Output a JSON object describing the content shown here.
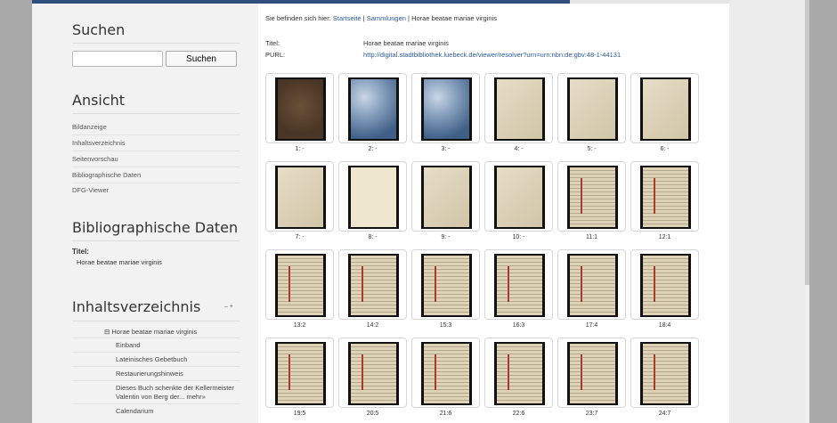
{
  "sidebar": {
    "search_heading": "Suchen",
    "search_placeholder": "",
    "search_button": "Suchen",
    "view_heading": "Ansicht",
    "view_links": [
      "Bildanzeige",
      "Inhaltsverzeichnis",
      "Seitenvorschau",
      "Bibliographische Daten",
      "DFG-Viewer"
    ],
    "bib_heading": "Bibliographische Daten",
    "bib_title_label": "Titel:",
    "bib_title_value": "Horae beatae mariae virginis",
    "toc_heading": "Inhaltsverzeichnis",
    "toc_toggle": "– +",
    "toc_root": "⊟ Horae beatae mariae virginis",
    "toc_items": [
      "Einband",
      "Lateinisches Gebetbuch",
      "Restaurierungshinweis",
      "Dieses Buch schenkte der Kellermeister",
      "Valentin von Berg der... mehr»",
      "Calendarium"
    ]
  },
  "breadcrumb": {
    "prefix": "Sie befinden sich hier:",
    "home": "Startseite",
    "sep": "|",
    "collections": "Sammlungen",
    "current": "Horae beatae mariae virginis"
  },
  "meta": {
    "title_label": "Titel:",
    "title_value": "Horae beatae mariae virginis",
    "purl_label": "PURL:",
    "purl_value": "http://digital.stadtbibliothek.luebeck.de/viewer/resolver?urn=urn:nbn:de:gbv:48-1-44131"
  },
  "thumbnails": [
    {
      "label": "1: -",
      "kind": "cover"
    },
    {
      "label": "2: -",
      "kind": "marble"
    },
    {
      "label": "3: -",
      "kind": "marble"
    },
    {
      "label": "4: -",
      "kind": "page"
    },
    {
      "label": "5: -",
      "kind": "page"
    },
    {
      "label": "6: -",
      "kind": "page"
    },
    {
      "label": "7: -",
      "kind": "page"
    },
    {
      "label": "8: -",
      "kind": "blank"
    },
    {
      "label": "9: -",
      "kind": "page"
    },
    {
      "label": "10: -",
      "kind": "page"
    },
    {
      "label": "11:1",
      "kind": "text"
    },
    {
      "label": "12:1",
      "kind": "text"
    },
    {
      "label": "13:2",
      "kind": "text"
    },
    {
      "label": "14:2",
      "kind": "text"
    },
    {
      "label": "15:3",
      "kind": "text"
    },
    {
      "label": "16:3",
      "kind": "text"
    },
    {
      "label": "17:4",
      "kind": "text"
    },
    {
      "label": "18:4",
      "kind": "text"
    },
    {
      "label": "19:5",
      "kind": "text"
    },
    {
      "label": "20:5",
      "kind": "text"
    },
    {
      "label": "21:6",
      "kind": "text"
    },
    {
      "label": "22:6",
      "kind": "text"
    },
    {
      "label": "23:7",
      "kind": "text"
    },
    {
      "label": "24:7",
      "kind": "text"
    }
  ],
  "colors": {
    "cover": "#4a3626",
    "marble": "#7f99b8",
    "page": "#e6ddc7",
    "blank": "#efe6cf",
    "text": "#ddd2b5",
    "rubric": "#a8392e",
    "link": "#2a5aa0"
  }
}
